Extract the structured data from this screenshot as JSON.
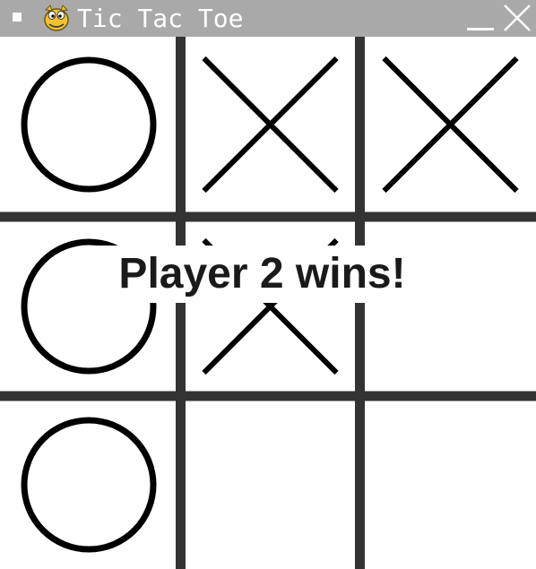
{
  "window": {
    "title": "Tic Tac Toe"
  },
  "colors": {
    "titlebar": "#a9a9a9",
    "grid": "#333333",
    "marks": "#000000",
    "background": "#ffffff"
  },
  "board": {
    "cells": [
      [
        "O",
        "X",
        "X"
      ],
      [
        "O",
        "X",
        ""
      ],
      [
        "O",
        "",
        ""
      ]
    ]
  },
  "status": {
    "message": "Player 2 wins!"
  },
  "icons": {
    "app": "python-snake-icon",
    "minimize": "minimize-icon",
    "close": "close-icon",
    "menu": "window-menu-icon"
  }
}
